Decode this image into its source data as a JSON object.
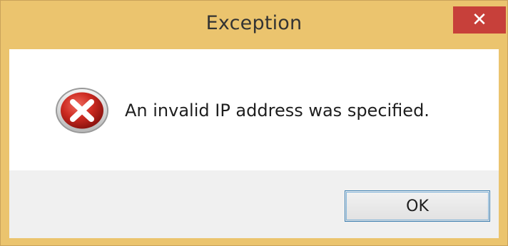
{
  "window": {
    "title": "Exception",
    "close_label": "✕",
    "frame_color": "#ebc46e",
    "close_color": "#c7403a"
  },
  "dialog": {
    "icon": "error-icon",
    "message": "An invalid IP address was specified.",
    "ok_label": "OK"
  }
}
